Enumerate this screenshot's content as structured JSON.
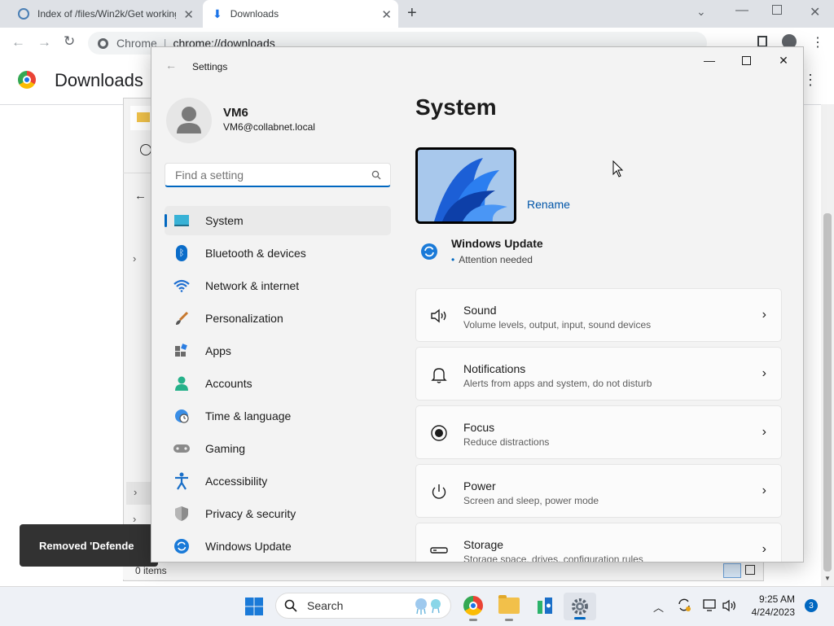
{
  "browser": {
    "tabs": [
      {
        "title": "Index of /files/Win2k/Get working"
      },
      {
        "title": "Downloads"
      }
    ],
    "omnibox": {
      "site": "Chrome",
      "url": "chrome://downloads"
    },
    "page_title": "Downloads"
  },
  "explorer": {
    "status": "0 items"
  },
  "toast": {
    "text": "Removed 'Defende"
  },
  "settings": {
    "window_title": "Settings",
    "user": {
      "name": "VM6",
      "email": "VM6@collabnet.local"
    },
    "search": {
      "placeholder": "Find a setting"
    },
    "nav": [
      {
        "label": "System",
        "icon": "system-icon"
      },
      {
        "label": "Bluetooth & devices",
        "icon": "bluetooth-icon"
      },
      {
        "label": "Network & internet",
        "icon": "wifi-icon"
      },
      {
        "label": "Personalization",
        "icon": "brush-icon"
      },
      {
        "label": "Apps",
        "icon": "apps-icon"
      },
      {
        "label": "Accounts",
        "icon": "accounts-icon"
      },
      {
        "label": "Time & language",
        "icon": "clock-globe-icon"
      },
      {
        "label": "Gaming",
        "icon": "gamepad-icon"
      },
      {
        "label": "Accessibility",
        "icon": "accessibility-icon"
      },
      {
        "label": "Privacy & security",
        "icon": "shield-icon"
      },
      {
        "label": "Windows Update",
        "icon": "update-icon"
      }
    ],
    "page_heading": "System",
    "rename_link": "Rename",
    "windows_update": {
      "title": "Windows Update",
      "status": "Attention needed"
    },
    "cards": [
      {
        "title": "Sound",
        "subtitle": "Volume levels, output, input, sound devices",
        "icon": "speaker-icon"
      },
      {
        "title": "Notifications",
        "subtitle": "Alerts from apps and system, do not disturb",
        "icon": "bell-icon"
      },
      {
        "title": "Focus",
        "subtitle": "Reduce distractions",
        "icon": "focus-icon"
      },
      {
        "title": "Power",
        "subtitle": "Screen and sleep, power mode",
        "icon": "power-icon"
      },
      {
        "title": "Storage",
        "subtitle": "Storage space, drives, configuration rules",
        "icon": "storage-icon"
      }
    ]
  },
  "taskbar": {
    "search_label": "Search",
    "time": "9:25 AM",
    "date": "4/24/2023",
    "notification_count": "3"
  },
  "colors": {
    "accent": "#0067c0",
    "selected_nav": "#eaeaea",
    "toast_bg": "#323232"
  }
}
